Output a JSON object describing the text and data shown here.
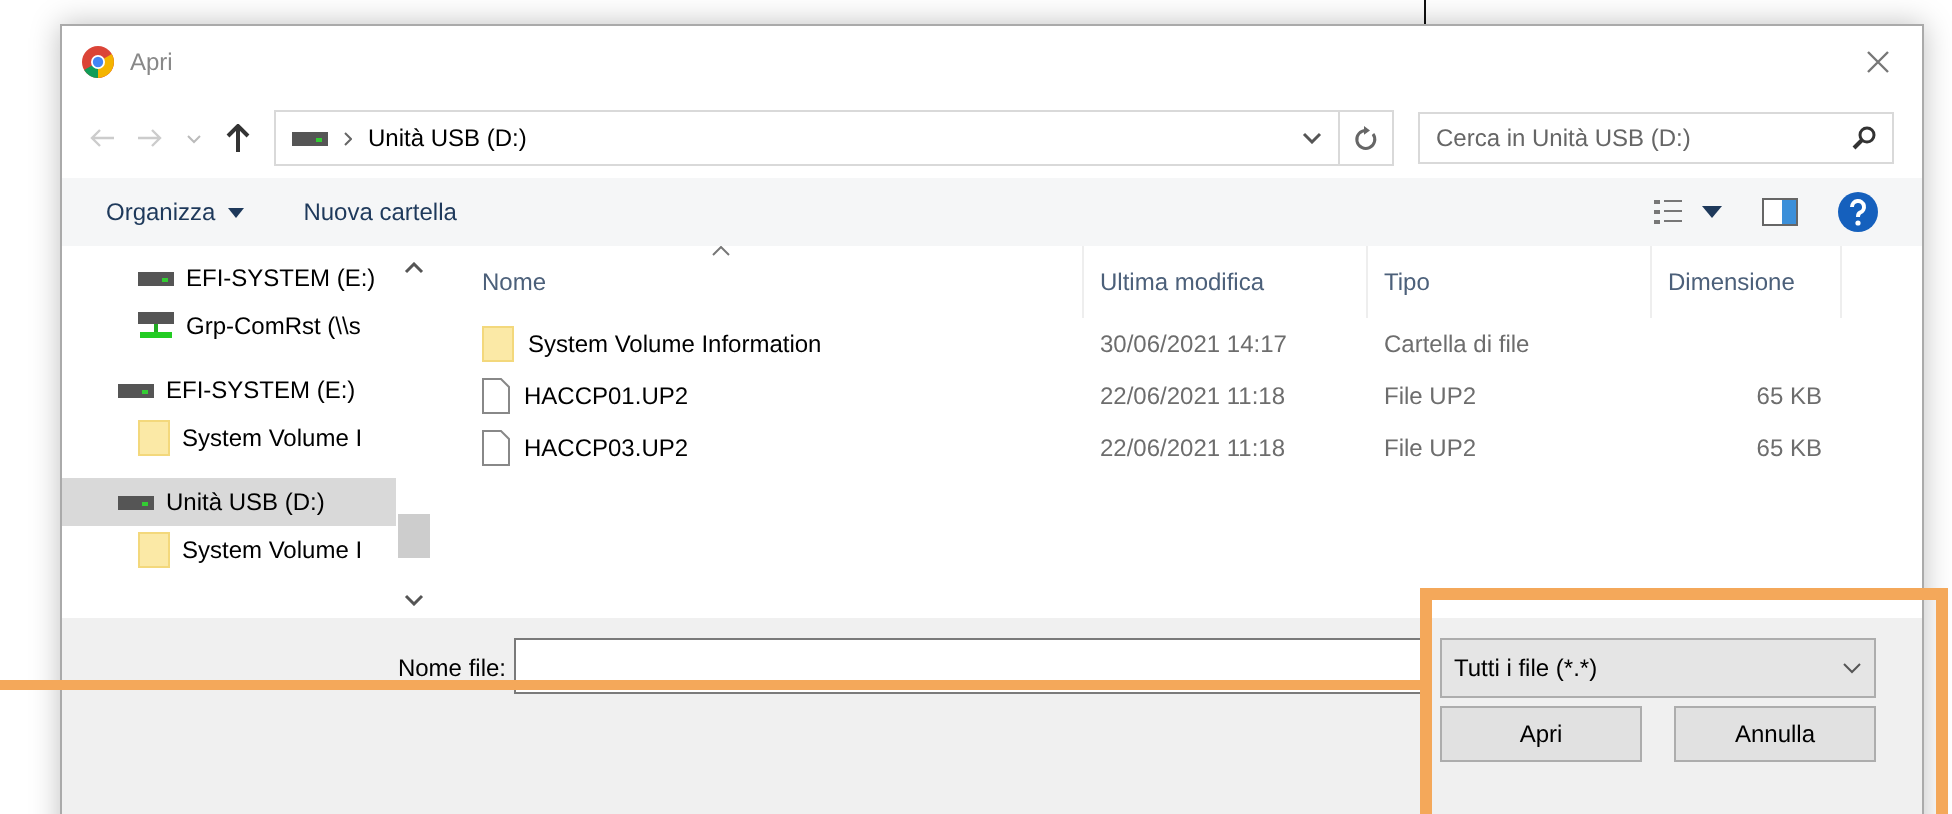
{
  "window": {
    "title": "Apri"
  },
  "navigation": {
    "path": "Unità USB (D:)",
    "search": {
      "placeholder": "Cerca in Unità USB (D:)"
    }
  },
  "toolbar": {
    "organize": "Organizza",
    "new_folder": "Nuova cartella"
  },
  "sidebar": {
    "scrolled_group": {
      "children": [
        {
          "label": "EFI-SYSTEM (E:)",
          "kind": "drive",
          "selected": false
        },
        {
          "label": "Grp-ComRst (\\\\s",
          "kind": "network",
          "selected": false
        }
      ]
    },
    "items": [
      {
        "label": "EFI-SYSTEM (E:)",
        "kind": "drive",
        "selected": false,
        "children": [
          {
            "label": "System Volume I",
            "kind": "folder",
            "selected": false
          }
        ]
      },
      {
        "label": "Unità USB (D:)",
        "kind": "drive",
        "selected": true,
        "children": [
          {
            "label": "System Volume I",
            "kind": "folder",
            "selected": false
          }
        ]
      }
    ]
  },
  "table": {
    "columns": [
      "Nome",
      "Ultima modifica",
      "Tipo",
      "Dimensione"
    ],
    "rows": [
      {
        "kind": "folder",
        "cells": [
          "System Volume Information",
          "30/06/2021 14:17",
          "Cartella di file",
          ""
        ]
      },
      {
        "kind": "file",
        "cells": [
          "HACCP01.UP2",
          "22/06/2021 11:18",
          "File UP2",
          "65 KB"
        ]
      },
      {
        "kind": "file",
        "cells": [
          "HACCP03.UP2",
          "22/06/2021 11:18",
          "File UP2",
          "65 KB"
        ]
      }
    ]
  },
  "footer": {
    "filename_label": "Nome file:",
    "file_type": "Tutti i file (*.*)",
    "buttons": [
      "Apri",
      "Annulla"
    ]
  }
}
